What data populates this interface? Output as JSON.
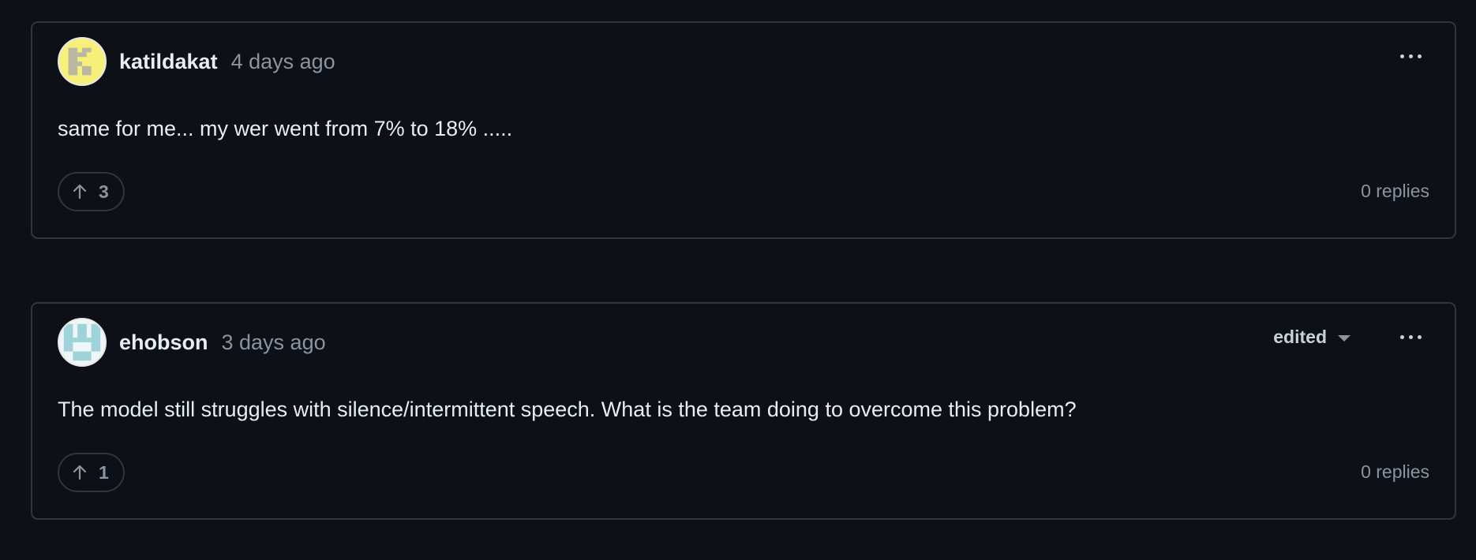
{
  "comments": [
    {
      "author": "katildakat",
      "time": "4 days ago",
      "body": "same for me... my wer went from 7% to 18% .....",
      "upvotes": "3",
      "replies": "0 replies",
      "avatar_icon": "identicon-yellow",
      "avatar_color": "#f5ef6e"
    },
    {
      "author": "ehobson",
      "time": "3 days ago",
      "edited_label": "edited",
      "body": "The model still struggles with silence/intermittent speech. What is the team doing to overcome this problem?",
      "upvotes": "1",
      "replies": "0 replies",
      "avatar_icon": "identicon-teal",
      "avatar_color": "#9fd3da"
    }
  ],
  "icons": {
    "upvote": "arrow-up-icon",
    "more": "kebab-horizontal-icon",
    "dropdown": "triangle-down-icon"
  },
  "colors": {
    "background": "#0d1117",
    "border": "#30363d",
    "muted_text": "#8b949e",
    "primary_text": "#e6edf3"
  }
}
